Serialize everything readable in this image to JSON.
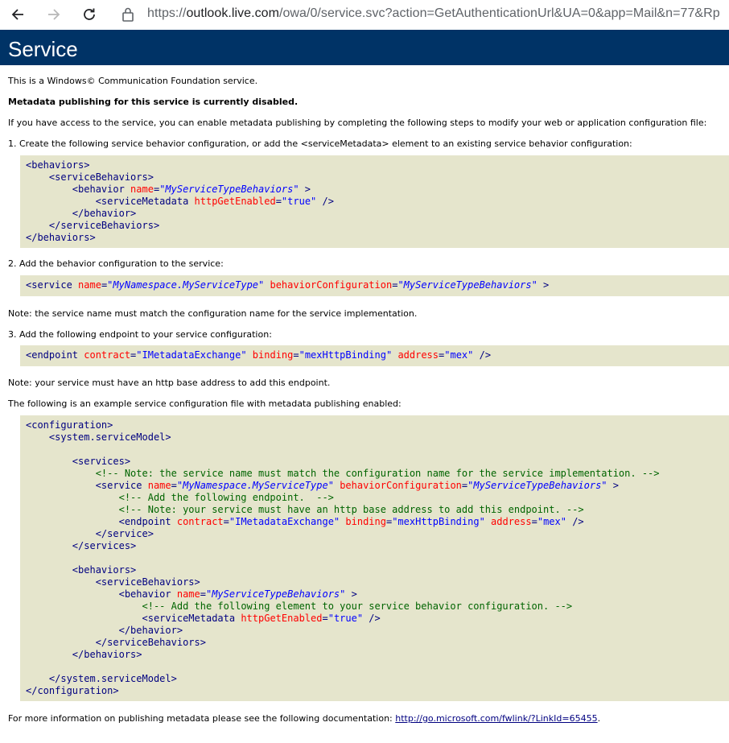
{
  "browser": {
    "url_prefix": "https://",
    "url_host": "outlook.live.com",
    "url_rest": "/owa/0/service.svc?action=GetAuthenticationUrl&UA=0&app=Mail&n=77&Rp"
  },
  "header": {
    "title": "Service"
  },
  "intro": "This is a Windows© Communication Foundation service.",
  "disabled_note": "Metadata publishing for this service is currently disabled.",
  "access_note": "If you have access to the service, you can enable metadata publishing by completing the following steps to modify your web or application configuration file:",
  "step1": "1. Create the following service behavior configuration, or add the <serviceMetadata> element to an existing service behavior configuration:",
  "step2": "2. Add the behavior configuration to the service:",
  "note_name": "Note: the service name must match the configuration name for the service implementation.",
  "step3": "3. Add the following endpoint to your service configuration:",
  "note_http": "Note: your service must have an http base address to add this endpoint.",
  "example_note": "The following is an example service configuration file with metadata publishing enabled:",
  "footer_text": "For more information on publishing metadata please see the following documentation: ",
  "footer_link": "http://go.microsoft.com/fwlink/?LinkId=65455",
  "footer_end": ".",
  "code": {
    "behaviors_open": "<behaviors>",
    "servicebehaviors_open": "<serviceBehaviors>",
    "behavior_open": "<behavior ",
    "name_attr": "name",
    "behavior_name_val": "\"MyServiceTypeBehaviors\"",
    "close_gt": " >",
    "servicemetadata_open": "<serviceMetadata ",
    "httpget_attr": "httpGetEnabled",
    "httpget_val": "\"true\"",
    "selfclose": " />",
    "behavior_close": "</behavior>",
    "servicebehaviors_close": "</serviceBehaviors>",
    "behaviors_close": "</behaviors>",
    "service_open": "<service ",
    "service_name_val": "\"MyNamespace.MyServiceType\"",
    "behaviorconfig_attr": "behaviorConfiguration",
    "behaviorconfig_val": "\"MyServiceTypeBehaviors\"",
    "endpoint_open": "<endpoint ",
    "contract_attr": "contract",
    "contract_val": "\"IMetadataExchange\"",
    "binding_attr": "binding",
    "binding_val": "\"mexHttpBinding\"",
    "address_attr": "address",
    "address_val": "\"mex\"",
    "configuration_open": "<configuration>",
    "systemsm_open": "<system.serviceModel>",
    "services_open": "<services>",
    "comment_name": "<!-- Note: the service name must match the configuration name for the service implementation. -->",
    "comment_endpoint": "<!-- Add the following endpoint.  -->",
    "comment_http": "<!-- Note: your service must have an http base address to add this endpoint. -->",
    "service_close": "</service>",
    "services_close": "</services>",
    "comment_behavior": "<!-- Add the following element to your service behavior configuration. -->",
    "systemsm_close": "</system.serviceModel>",
    "configuration_close": "</configuration>",
    "eq": "="
  }
}
